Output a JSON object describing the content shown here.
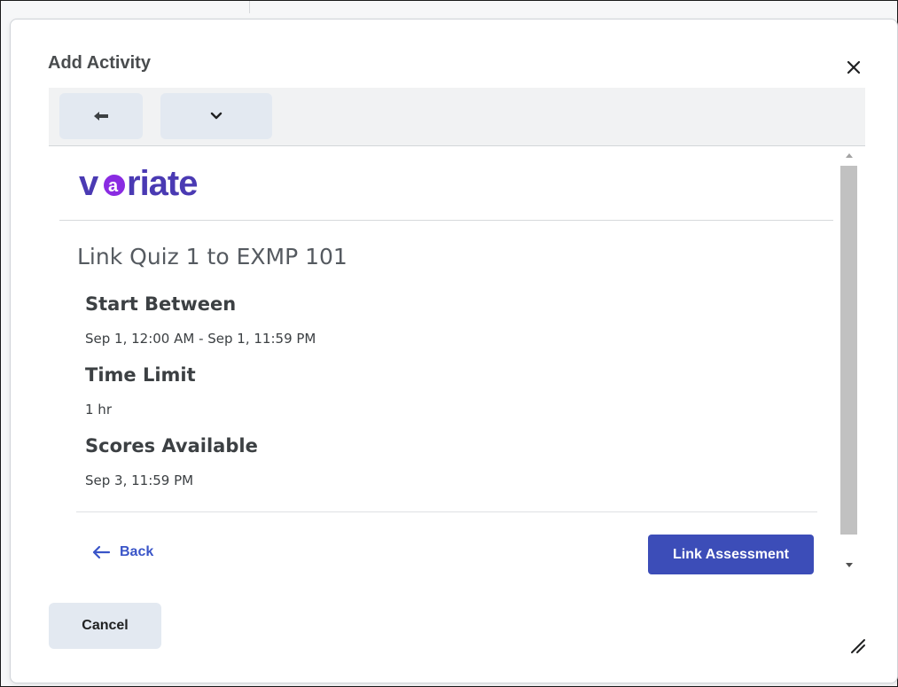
{
  "dialog": {
    "title": "Add Activity",
    "close_icon": "close-icon",
    "cancel_label": "Cancel"
  },
  "toolbar": {
    "back_icon": "arrow-left-icon",
    "menu_icon": "chevron-down-icon"
  },
  "content": {
    "logo_text": "variate",
    "title": "Link Quiz 1 to EXMP 101",
    "sections": [
      {
        "label": "Start Between",
        "value": "Sep 1, 12:00 AM - Sep 1, 11:59 PM"
      },
      {
        "label": "Time Limit",
        "value": "1 hr"
      },
      {
        "label": "Scores Available",
        "value": "Sep 3, 11:59 PM"
      }
    ],
    "back_label": "Back",
    "link_button_label": "Link Assessment"
  },
  "colors": {
    "primary_button": "#3c4db8",
    "link": "#3a55c8",
    "logo_purple": "#4a3ab3",
    "logo_accent": "#8a2be2"
  }
}
